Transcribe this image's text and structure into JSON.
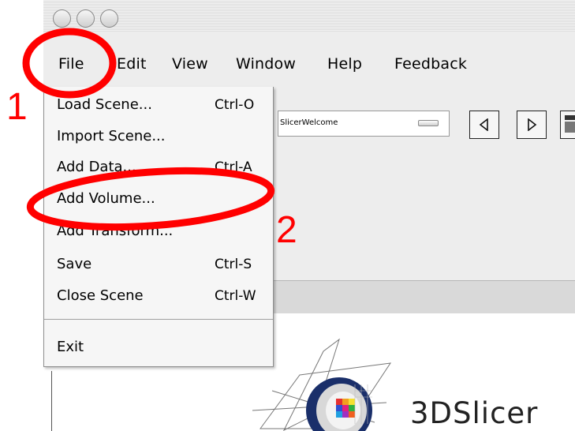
{
  "menubar": {
    "items": [
      "File",
      "Edit",
      "View",
      "Window",
      "Help",
      "Feedback"
    ]
  },
  "file_menu": {
    "items": [
      {
        "label": "Load Scene...",
        "shortcut": "Ctrl-O"
      },
      {
        "label": "Import Scene...",
        "shortcut": ""
      },
      {
        "label": "Add Data...",
        "shortcut": "Ctrl-A"
      },
      {
        "label": "Add Volume...",
        "shortcut": ""
      },
      {
        "label": "Add Transform...",
        "shortcut": ""
      },
      {
        "label": "Save",
        "shortcut": "Ctrl-S"
      },
      {
        "label": "Close Scene",
        "shortcut": "Ctrl-W"
      },
      {
        "label": "Exit",
        "shortcut": ""
      }
    ]
  },
  "toolbar": {
    "module_selector": "SlicerWelcome"
  },
  "annotations": {
    "step1": "1",
    "step2": "2"
  },
  "logo": {
    "text": "3DSlicer"
  },
  "colors": {
    "annotation": "#ff0000",
    "menu_background": "#f6f6f6",
    "menubar_background": "#ededed"
  },
  "icons": [
    "window-close-icon",
    "window-minimize-icon",
    "window-zoom-icon",
    "back-arrow-icon",
    "forward-arrow-icon",
    "layout-icon",
    "slicer-logo-icon"
  ]
}
